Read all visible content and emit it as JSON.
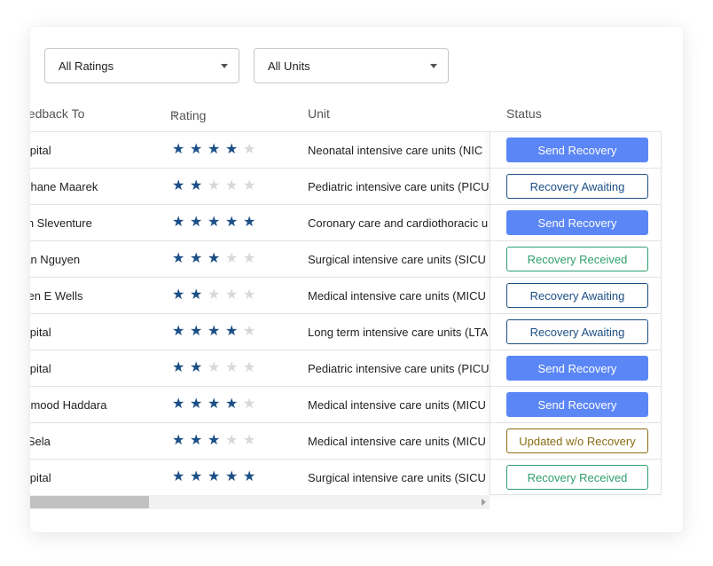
{
  "filters": {
    "ratings": "All Ratings",
    "units": "All Units"
  },
  "columns": {
    "feedback_to": "eedback To",
    "rating": "Rating",
    "sort_arrow": "↑",
    "unit": "Unit",
    "status": "Status"
  },
  "rows": [
    {
      "name": "ospital",
      "rating": 4,
      "unit": "Neonatal intensive care units (NIC",
      "status": "Send Recovery",
      "status_type": "send"
    },
    {
      "name": "ephane Maarek",
      "rating": 2,
      "unit": "Pediatric intensive care units (PICU",
      "status": "Recovery Awaiting",
      "status_type": "awaiting"
    },
    {
      "name": "am Sleventure",
      "rating": 5,
      "unit": "Coronary care and cardiothoracic u",
      "status": "Send Recovery",
      "status_type": "send"
    },
    {
      "name": "han Nguyen",
      "rating": 3,
      "unit": "Surgical intensive care units (SICU",
      "status": "Recovery Received",
      "status_type": "received"
    },
    {
      "name": "aren E Wells",
      "rating": 2,
      "unit": "Medical intensive care units (MICU",
      "status": "Recovery Awaiting",
      "status_type": "awaiting"
    },
    {
      "name": "ospital",
      "rating": 4,
      "unit": "Long term intensive care units (LTA",
      "status": "Recovery Awaiting",
      "status_type": "awaiting"
    },
    {
      "name": "ospital",
      "rating": 2,
      "unit": "Pediatric intensive care units (PICU",
      "status": "Send Recovery",
      "status_type": "send"
    },
    {
      "name": "ahmood Haddara",
      "rating": 4,
      "unit": "Medical intensive care units (MICU",
      "status": "Send Recovery",
      "status_type": "send"
    },
    {
      "name": "ri Sela",
      "rating": 3,
      "unit": "Medical intensive care units (MICU",
      "status": "Updated w/o Recovery",
      "status_type": "updated"
    },
    {
      "name": "ospital",
      "rating": 5,
      "unit": "Surgical intensive care units (SICU",
      "status": "Recovery Received",
      "status_type": "received"
    }
  ],
  "rating_max": 5,
  "colors": {
    "star_on": "#1b4f86",
    "star_off": "#d8d8d8",
    "send": "#5b86f5",
    "awaiting": "#1b4f86",
    "received": "#2e9e6e",
    "updated": "#8a6d12"
  },
  "icons": {
    "dropdown": "chevron-down-icon",
    "star": "star-icon",
    "sort": "sort-ascending-icon",
    "scroll_right": "scroll-right-icon"
  }
}
